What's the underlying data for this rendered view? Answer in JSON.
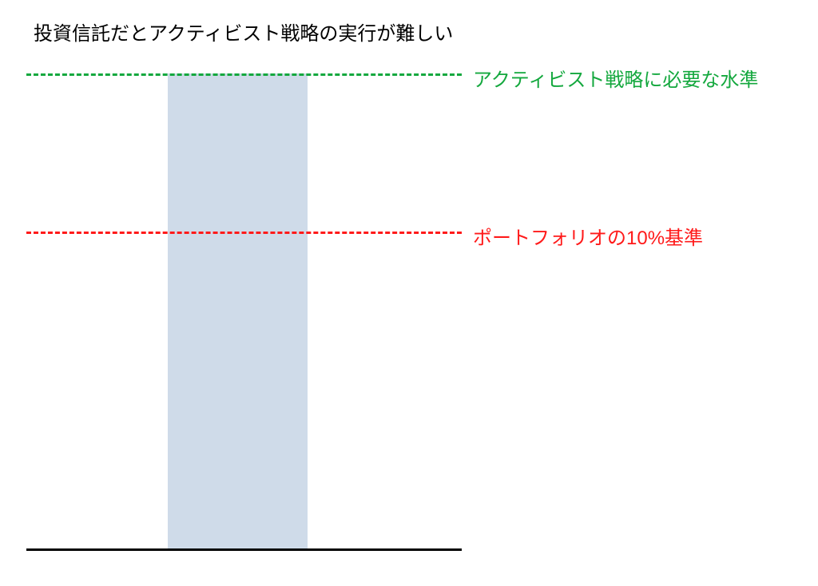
{
  "title": "投資信託だとアクティビスト戦略の実行が難しい",
  "labels": {
    "green": "アクティビスト戦略に必要な水準",
    "red": "ポートフォリオの10%基準"
  },
  "chart_data": {
    "type": "bar",
    "categories": [
      ""
    ],
    "values": [
      100
    ],
    "ylim": [
      0,
      104
    ],
    "reference_lines": [
      {
        "name": "アクティビスト戦略に必要な水準",
        "value": 100,
        "color": "#14a83e",
        "style": "dashed"
      },
      {
        "name": "ポートフォリオの10%基準",
        "value": 67,
        "color": "#ff1a1a",
        "style": "dashed"
      }
    ],
    "title": "投資信託だとアクティビスト戦略の実行が難しい",
    "xlabel": "",
    "ylabel": "",
    "bar_color": "#cfdbe9"
  }
}
